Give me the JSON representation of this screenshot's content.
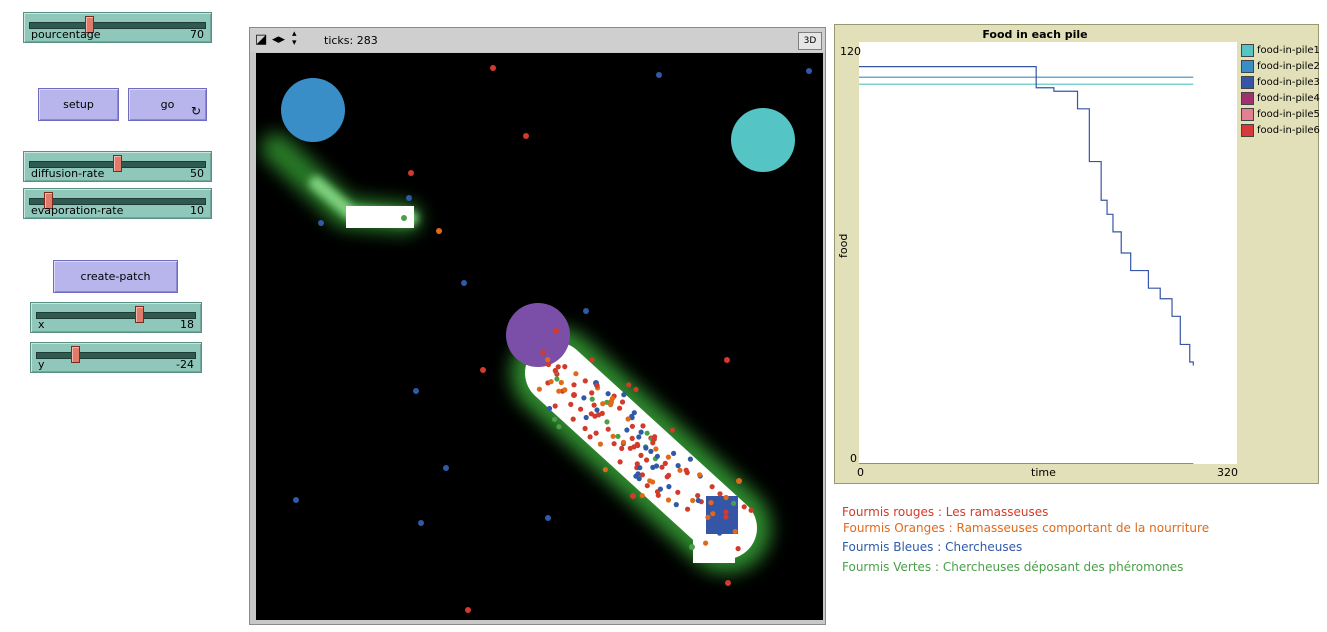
{
  "sliders": {
    "pourcentage": {
      "label": "pourcentage",
      "value": "70",
      "fraction": 0.7
    },
    "diffusion_rate": {
      "label": "diffusion-rate",
      "value": "50",
      "fraction": 0.5
    },
    "evaporation_rate": {
      "label": "evaporation-rate",
      "value": "10",
      "fraction": 0.1
    },
    "x": {
      "label": "x",
      "value": "18",
      "fraction": 0.68
    },
    "y": {
      "label": "y",
      "value": "-24",
      "fraction": 0.25
    }
  },
  "buttons": {
    "setup": "setup",
    "go": "go",
    "create_patch": "create-patch"
  },
  "view": {
    "ticks_label": "ticks: 283",
    "btn_3d": "3D"
  },
  "plot": {
    "title": "Food in each pile",
    "y_max": "120",
    "y_min": "0",
    "x_min": "0",
    "x_max": "320",
    "x_label": "time",
    "y_label": "food",
    "legend": [
      {
        "name": "food-in-pile1",
        "color": "#54c4c4"
      },
      {
        "name": "food-in-pile2",
        "color": "#3a8ec8"
      },
      {
        "name": "food-in-pile3",
        "color": "#3556a6"
      },
      {
        "name": "food-in-pile4",
        "color": "#a03070"
      },
      {
        "name": "food-in-pile5",
        "color": "#e08090"
      },
      {
        "name": "food-in-pile6",
        "color": "#d73a3a"
      }
    ]
  },
  "chart_data": {
    "type": "line",
    "title": "Food in each pile",
    "xlabel": "time",
    "ylabel": "food",
    "xlim": [
      0,
      320
    ],
    "ylim": [
      0,
      120
    ],
    "series": [
      {
        "name": "food-in-pile1",
        "color": "#54c4c4",
        "x": [
          0,
          283
        ],
        "y": [
          108,
          108
        ]
      },
      {
        "name": "food-in-pile2",
        "color": "#3a8ec8",
        "x": [
          0,
          260,
          283
        ],
        "y": [
          110,
          110,
          110
        ]
      },
      {
        "name": "food-in-pile3",
        "color": "#3556a6",
        "x": [
          0,
          145,
          150,
          165,
          185,
          195,
          205,
          210,
          215,
          222,
          230,
          245,
          255,
          265,
          272,
          280,
          283
        ],
        "y": [
          113,
          113,
          107,
          106,
          101,
          86,
          75,
          71,
          66,
          60,
          55,
          50,
          47,
          42,
          34,
          29,
          28
        ]
      },
      {
        "name": "food-in-pile4",
        "color": "#a03070",
        "x": [
          0,
          283
        ],
        "y": [
          0,
          0
        ]
      },
      {
        "name": "food-in-pile5",
        "color": "#e08090",
        "x": [
          0,
          283
        ],
        "y": [
          0,
          0
        ]
      },
      {
        "name": "food-in-pile6",
        "color": "#d73a3a",
        "x": [
          0,
          283
        ],
        "y": [
          0,
          0
        ]
      }
    ]
  },
  "info": {
    "red": {
      "text": "Fourmis rouges : Les ramasseuses",
      "color": "#d23a2a"
    },
    "orange": {
      "text": "Fourmis Oranges : Ramasseuses comportant de la nourriture",
      "color": "#e06a1a"
    },
    "blue": {
      "text": "Fourmis Bleues : Chercheuses",
      "color": "#2f5aa8"
    },
    "green": {
      "text": "Fourmis Vertes : Chercheuses déposant des phéromones",
      "color": "#4aa04a"
    }
  },
  "colors": {
    "slider": "#8fc8bb",
    "button": "#b7b5ec",
    "plot_bg": "#e2e0b8",
    "world": "#000000"
  }
}
